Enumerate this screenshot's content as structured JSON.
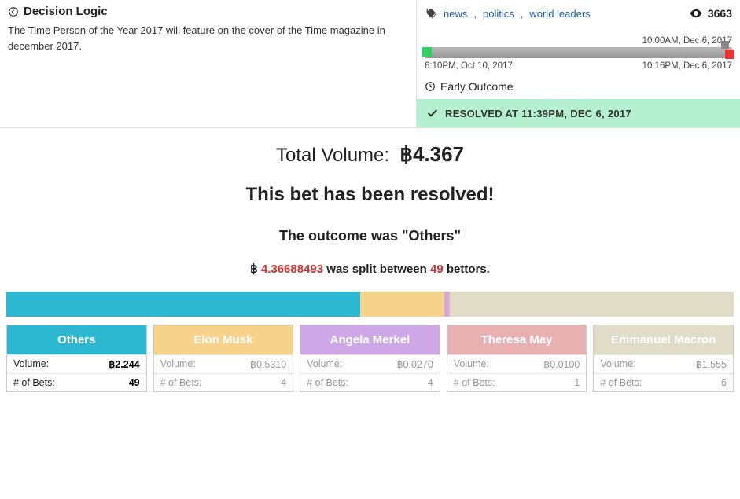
{
  "decision_logic": {
    "title": "Decision Logic",
    "body": "The Time Person of the Year 2017 will feature on the cover of the Time magazine in december 2017."
  },
  "tags": [
    "news",
    "politics",
    "world leaders"
  ],
  "views": "3663",
  "timeline": {
    "top_right": "10:00AM, Dec 6, 2017",
    "bottom_left": "6:10PM, Oct 10, 2017",
    "bottom_right": "10:16PM, Dec 6, 2017"
  },
  "early_outcome": "Early Outcome",
  "resolved_bar": "RESOLVED AT 11:39PM, DEC 6, 2017",
  "total_volume_label": "Total Volume:",
  "total_volume_value": "฿4.367",
  "resolved_msg": "This bet has been resolved!",
  "outcome_msg": "The outcome was \"Others\"",
  "split": {
    "sym": "฿",
    "amount": "4.36688493",
    "mid": " was split between ",
    "bettors": "49",
    "suffix": " bettors."
  },
  "cards": [
    {
      "name": "Others",
      "volume": "฿2.244",
      "bets": "49"
    },
    {
      "name": "Elon Musk",
      "volume": "฿0.5310",
      "bets": "4"
    },
    {
      "name": "Angela Merkel",
      "volume": "฿0.0270",
      "bets": "4"
    },
    {
      "name": "Theresa May",
      "volume": "฿0.0100",
      "bets": "1"
    },
    {
      "name": "Emmanuel Macron",
      "volume": "฿1.555",
      "bets": "6"
    }
  ],
  "labels": {
    "volume": "Volume:",
    "bets": "# of Bets:"
  }
}
